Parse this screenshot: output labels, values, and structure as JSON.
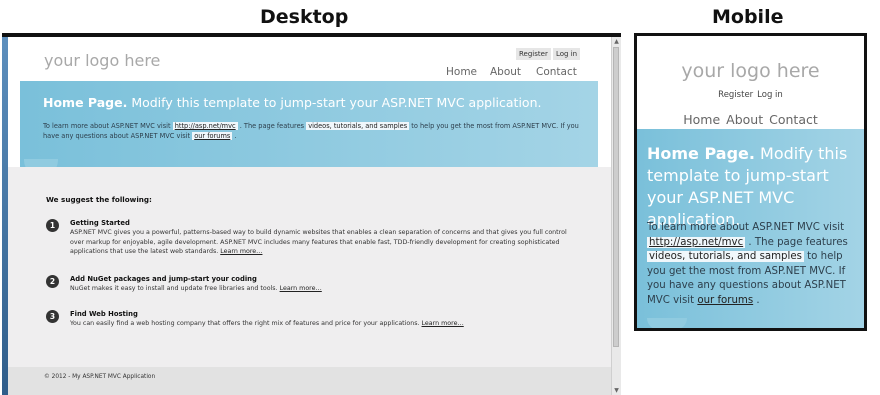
{
  "headings": {
    "desktop": "Desktop",
    "mobile": "Mobile"
  },
  "site": {
    "logo": "your logo here",
    "register": "Register",
    "login": "Log in",
    "nav": {
      "home": "Home",
      "about": "About",
      "contact": "Contact"
    },
    "hero": {
      "title_bold": "Home Page.",
      "title_rest": " Modify this template to jump-start your ASP.NET MVC application.",
      "text_1": "To learn more about ASP.NET MVC visit ",
      "link_url": "http://asp.net/mvc",
      "text_2": " . The page features ",
      "highlight": "videos, tutorials, and samples",
      "text_3": " to help you get the most from ASP.NET MVC. If you have any questions about ASP.NET MVC visit ",
      "forums": "our forums",
      "text_4": " ."
    },
    "suggest_heading": "We suggest the following:",
    "items": [
      {
        "num": "1",
        "title": "Getting Started",
        "desc": "ASP.NET MVC gives you a powerful, patterns-based way to build dynamic websites that enables a clean separation of concerns and that gives you full control over markup for enjoyable, agile development. ASP.NET MVC includes many features that enable fast, TDD-friendly development for creating sophisticated applications that use the latest web standards. ",
        "link": "Learn more…"
      },
      {
        "num": "2",
        "title": "Add NuGet packages and jump-start your coding",
        "desc": "NuGet makes it easy to install and update free libraries and tools. ",
        "link": "Learn more…"
      },
      {
        "num": "3",
        "title": "Find Web Hosting",
        "desc": "You can easily find a web hosting company that offers the right mix of features and price for your applications. ",
        "link": "Learn more…"
      }
    ],
    "footer": "© 2012 - My ASP.NET MVC Application"
  }
}
